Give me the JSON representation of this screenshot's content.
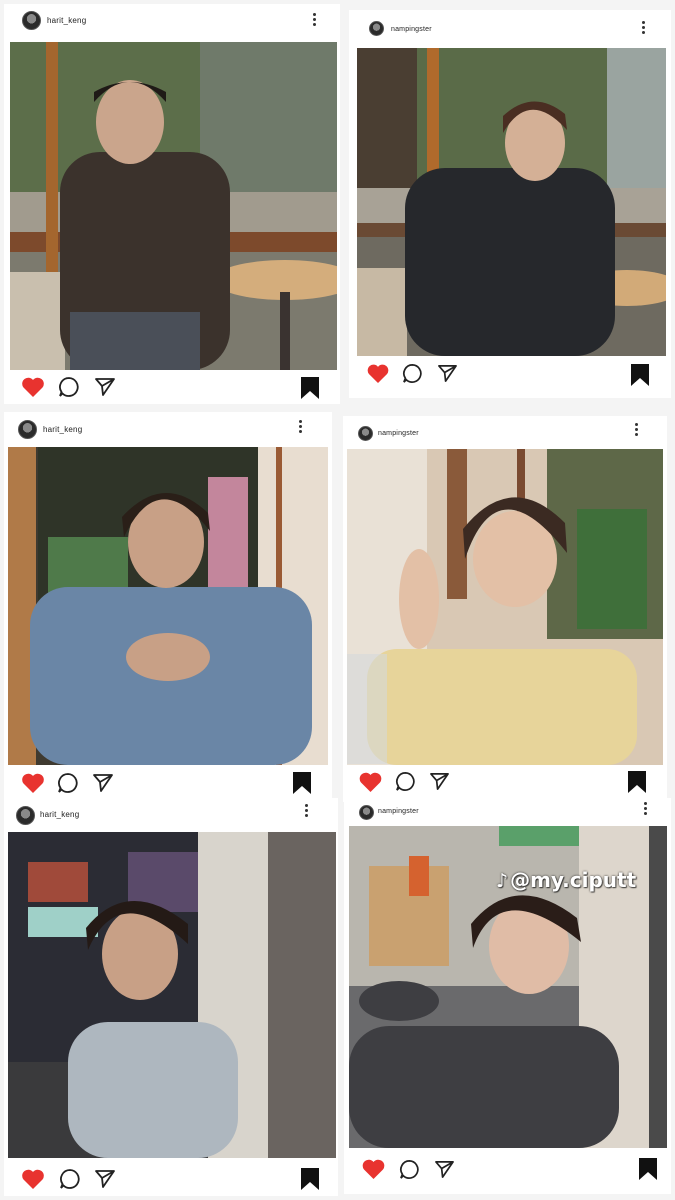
{
  "posts": [
    {
      "username": "harit_keng",
      "photo": "man in striped sweater seated at cafe table"
    },
    {
      "username": "nampingster",
      "photo": "smiling person in dark shirt seated at cafe table"
    },
    {
      "username": "harit_keng",
      "photo": "man in denim shirt with clasped hands"
    },
    {
      "username": "nampingster",
      "photo": "person in yellow shirt resting head on hand"
    },
    {
      "username": "harit_keng",
      "photo": "man in denim jacket on city street at night"
    },
    {
      "username": "nampingster",
      "photo": "person in grey top leaning on pillar"
    }
  ],
  "watermark": {
    "icon": "tiktok-icon",
    "handle": "@my.ciputt"
  },
  "colors": {
    "heart": "#e8332f",
    "icon": "#222222",
    "card": "#ffffff",
    "background": "#f4f4f4"
  }
}
